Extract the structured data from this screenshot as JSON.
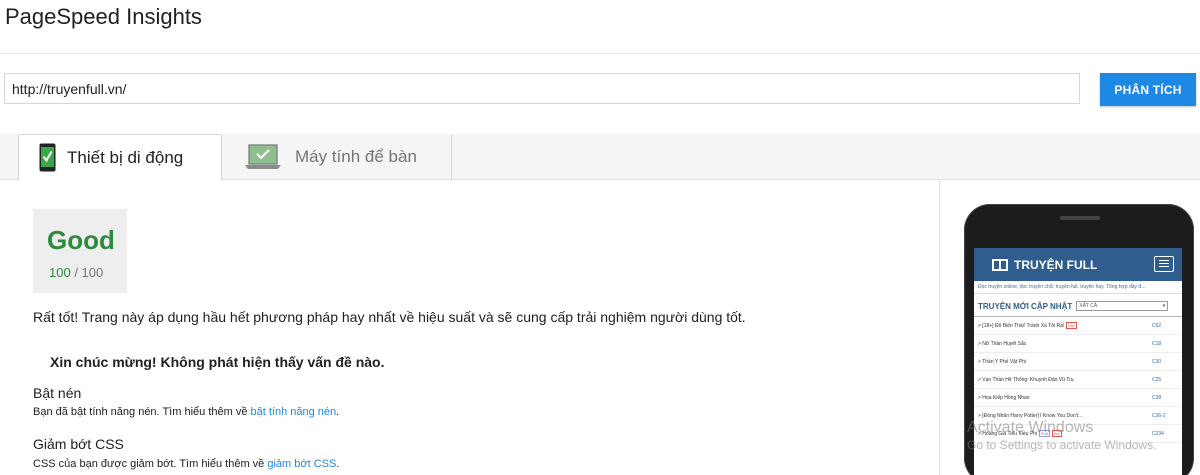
{
  "app": {
    "title": "PageSpeed Insights"
  },
  "search": {
    "url_value": "http://truyenfull.vn/",
    "analyze_label": "PHÂN TÍCH"
  },
  "tabs": [
    {
      "label": "Thiết bị di động",
      "icon": "mobile-check-icon",
      "selected": true
    },
    {
      "label": "Máy tính để bàn",
      "icon": "desktop-check-icon",
      "selected": false
    }
  ],
  "result": {
    "rating": "Good",
    "score": "100",
    "score_max": "/ 100",
    "summary": "Rất tốt! Trang này áp dụng hầu hết phương pháp hay nhất về hiệu suất và sẽ cung cấp trải nghiệm người dùng tốt.",
    "congrats": "Xin chúc mừng! Không phát hiện thấy vấn đề nào.",
    "rules": [
      {
        "title": "Bật nén",
        "desc": "Bạn đã bật tính năng nén. Tìm hiểu thêm về ",
        "link": "bật tính năng nén",
        "end": "."
      },
      {
        "title": "Giảm bớt CSS",
        "desc": "CSS của bạn được giảm bớt. Tìm hiểu thêm về ",
        "link": "giảm bớt CSS",
        "end": "."
      }
    ]
  },
  "preview": {
    "site_name": "TRUYỆN FULL",
    "tagline": "Đọc truyện online, đọc truyện chữ, truyện full, truyện hay. Tổng hợp đầy đ...",
    "list_title": "TRUYỆN MỚI CẬP NHẬT",
    "filter": "XẤT CẢ",
    "filter_caret": "▾",
    "stories": [
      {
        "title": "> [18+] Đô Biến Thái! Tránh Xa Tôi Ra!",
        "tag": "Hot",
        "chapter": "C62"
      },
      {
        "title": "> Nữ Thần Huyết Sắc",
        "tag": "",
        "chapter": "C18"
      },
      {
        "title": "> Thần Y Phế Vật Phi",
        "tag": "",
        "chapter": "C30"
      },
      {
        "title": "> Vạn Thần Hệ Thống: Khuynh Đảo Vũ Trụ",
        "tag": "",
        "chapter": "C25"
      },
      {
        "title": "> Họa Kiếp Hồng Nhan",
        "tag": "",
        "chapter": "C38"
      },
      {
        "title": "> [Đồng Nhân Harry Potter] I Know You Don't...",
        "tag": "",
        "chapter": "C36-2"
      },
      {
        "title": "> Hoàng Gia Tiểu Kiều Phi",
        "tag": "Full",
        "tag2": "Hot",
        "chapter": "C234"
      }
    ]
  },
  "watermark": {
    "title": "Activate Windows",
    "subtitle": "Go to Settings to activate Windows."
  },
  "colors": {
    "accent": "#1e88e5",
    "good": "#2e8b3d",
    "site_header": "#2f5d8e"
  }
}
